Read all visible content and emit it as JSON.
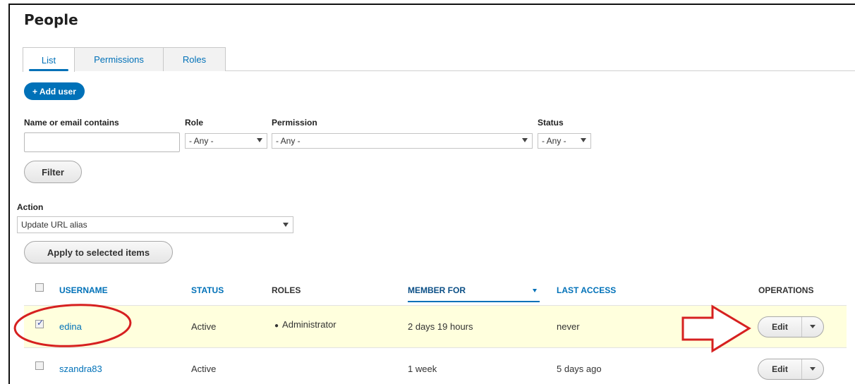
{
  "page": {
    "title": "People"
  },
  "tabs": [
    {
      "label": "List",
      "active": true
    },
    {
      "label": "Permissions",
      "active": false
    },
    {
      "label": "Roles",
      "active": false
    }
  ],
  "add_user_label": "+ Add user",
  "filters": {
    "name_label": "Name or email contains",
    "name_value": "",
    "role_label": "Role",
    "role_value": "- Any -",
    "permission_label": "Permission",
    "permission_value": "- Any -",
    "status_label": "Status",
    "status_value": "- Any -",
    "filter_button": "Filter"
  },
  "action": {
    "label": "Action",
    "value": "Update URL alias",
    "apply_button": "Apply to selected items"
  },
  "table": {
    "headers": {
      "username": "USERNAME",
      "status": "STATUS",
      "roles": "ROLES",
      "member_for": "MEMBER FOR",
      "last_access": "LAST ACCESS",
      "operations": "OPERATIONS"
    },
    "rows": [
      {
        "username": "edina",
        "status": "Active",
        "role": "Administrator",
        "member_for": "2 days 19 hours",
        "last_access": "never",
        "operation": "Edit",
        "checked": true
      },
      {
        "username": "szandra83",
        "status": "Active",
        "role": "",
        "member_for": "1 week",
        "last_access": "5 days ago",
        "operation": "Edit",
        "checked": false
      }
    ]
  },
  "colors": {
    "link": "#0071b8",
    "selected_row": "#ffffdd",
    "annotation": "#d62020"
  }
}
